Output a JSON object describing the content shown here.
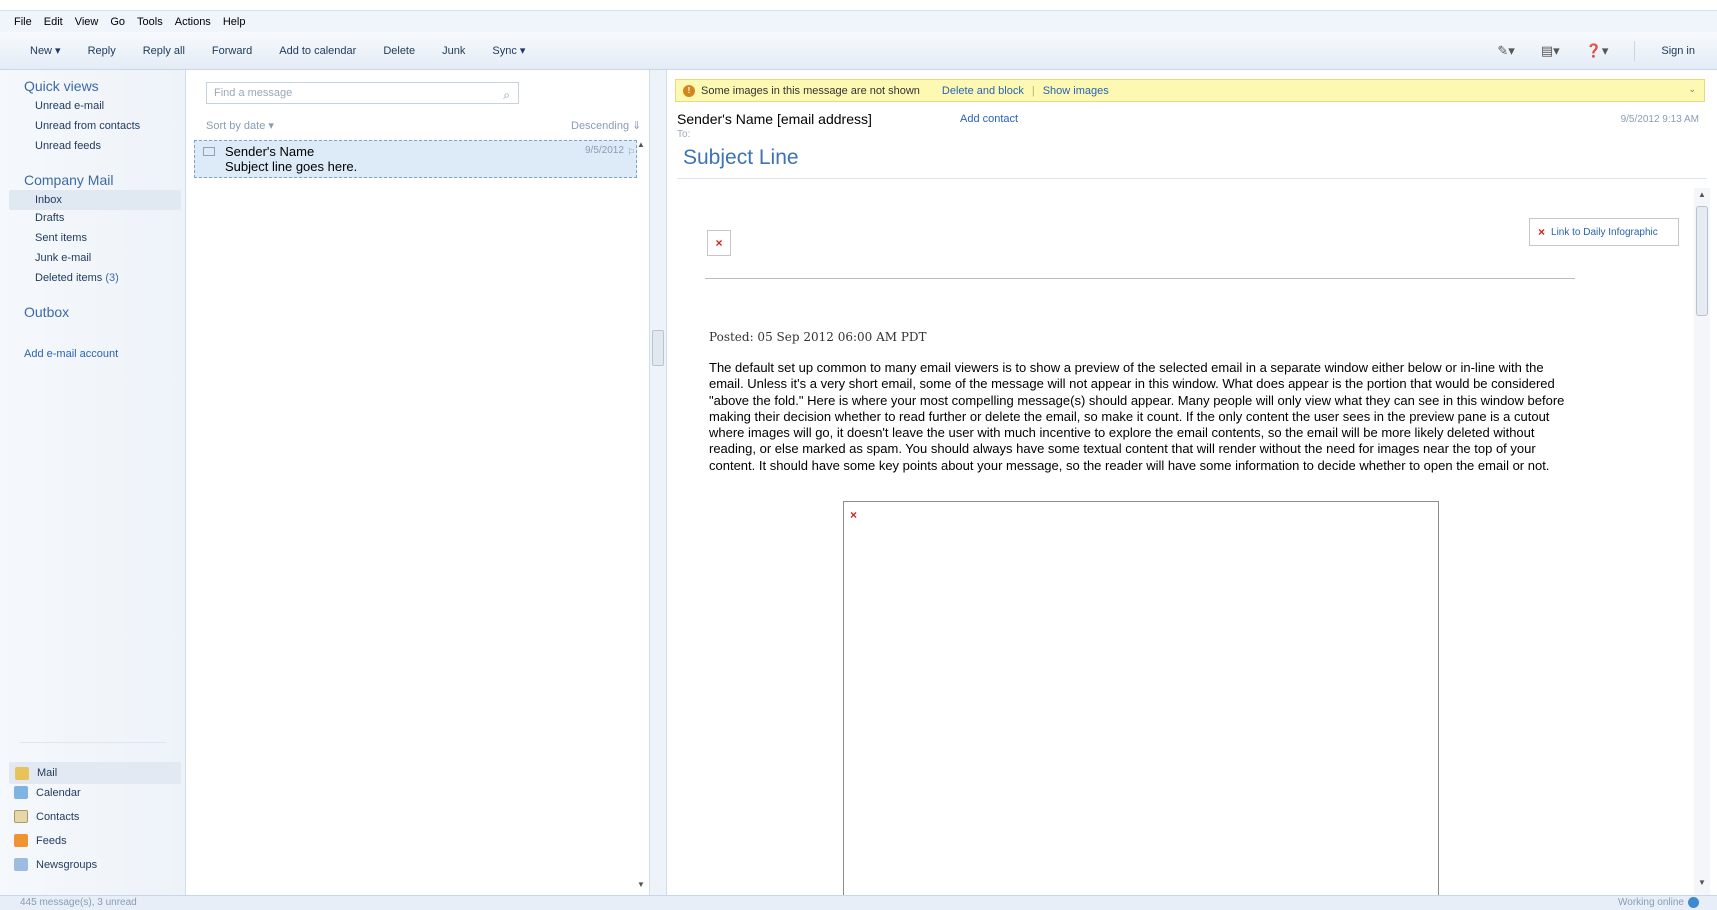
{
  "menubar": [
    "File",
    "Edit",
    "View",
    "Go",
    "Tools",
    "Actions",
    "Help"
  ],
  "toolbar": {
    "buttons": [
      "New ▾",
      "Reply",
      "Reply all",
      "Forward",
      "Add to calendar",
      "Delete",
      "Junk",
      "Sync ▾"
    ],
    "sign_in": "Sign in"
  },
  "sidebar": {
    "quick_views_title": "Quick views",
    "quick_views": [
      "Unread e-mail",
      "Unread from contacts",
      "Unread feeds"
    ],
    "company_mail_title": "Company Mail",
    "folders": [
      {
        "label": "Inbox"
      },
      {
        "label": "Drafts"
      },
      {
        "label": "Sent items"
      },
      {
        "label": "Junk e-mail"
      },
      {
        "label": "Deleted items",
        "count": "(3)"
      }
    ],
    "outbox_title": "Outbox",
    "add_account": "Add e-mail account",
    "modules": [
      "Mail",
      "Calendar",
      "Contacts",
      "Feeds",
      "Newsgroups"
    ]
  },
  "message_list": {
    "search_placeholder": "Find a message",
    "sort_label": "Sort by date ▾",
    "order_label": "Descending ⇓",
    "messages": [
      {
        "sender": "Sender's Name",
        "subject": "Subject line goes here.",
        "date": "9/5/2012"
      }
    ]
  },
  "reading_pane": {
    "infobar_text": "Some images in this message are not shown",
    "infobar_delete": "Delete and block",
    "infobar_show": "Show images",
    "sender": "Sender's Name [email address]",
    "add_contact": "Add contact",
    "date": "9/5/2012 9:13 AM",
    "to_label": "To:",
    "subject": "Subject Line",
    "link_infographic": "Link to Daily Infographic",
    "posted": "Posted: 05 Sep 2012 06:00 AM PDT",
    "body_text": "The default set up common to many email viewers is to show a preview of the selected email in a separate window either below or in-line with the email. Unless it's a very short email, some of the message will not appear in this window. What does appear is the portion that would be considered \"above the fold.\" Here is where your most compelling message(s) should appear. Many people will only view what they can see in this window before making their decision whether to read further or delete the email, so make it count. If the only content the user sees in the preview pane is a cutout where images will go, it doesn't leave the user with much incentive to explore the email contents, so the email will be more likely deleted without reading, or else marked as spam. You should always have some textual content that will render without the need for images near the top of your content. It should have some key points about your message, so the reader will have some information to decide whether to open the email or not."
  },
  "statusbar": {
    "messages": "445 message(s), 3 unread",
    "status": "Working online"
  },
  "colors": {
    "accent": "#3d73b5",
    "link": "#2a62b6",
    "infobar_bg": "#fdf9b3",
    "selected_row": "#dcebf7"
  }
}
